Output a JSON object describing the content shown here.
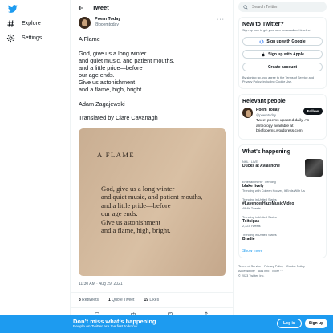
{
  "nav": {
    "explore": "Explore",
    "settings": "Settings"
  },
  "header": {
    "title": "Tweet"
  },
  "tweet": {
    "author_name": "Poem Today",
    "author_handle": "@poemtoday",
    "title": "A Flame",
    "lines": [
      "God, give us a long winter",
      "and quiet music, and patient mouths,",
      "and a little pride—before",
      "our age ends.",
      "Give us astonishment",
      "and a flame, high, bright."
    ],
    "poet": "Adam Zagajewski",
    "translator": "Translated by Clare Cavanagh",
    "photo_title": "A FLAME",
    "photo_lines": [
      "God, give us a long winter",
      "and quiet music, and patient mouths,",
      "and a little pride—before",
      "our age ends.",
      "Give us astonishment",
      "and a flame, high, bright."
    ],
    "timestamp": "11:30 AM · Aug 29, 2021",
    "retweets_count": "3",
    "retweets_label": "Retweets",
    "quotes_count": "1",
    "quotes_label": "Quote Tweet",
    "likes_count": "19",
    "likes_label": "Likes"
  },
  "search": {
    "placeholder": "Search Twitter"
  },
  "new_to_twitter": {
    "title": "New to Twitter?",
    "subtitle": "Sign up now to get your own personalized timeline!",
    "google": "Sign up with Google",
    "apple": "Sign up with Apple",
    "create": "Create account",
    "terms": "By signing up, you agree to the Terms of Service and Privacy Policy, including Cookie Use."
  },
  "relevant": {
    "title": "Relevant people",
    "name": "Poem Today",
    "handle": "@poemtoday",
    "follow": "Follow",
    "bio": "Tweet poems updated daily. An anthology available at briefpoems.wordpress.com"
  },
  "happening": {
    "title": "What's happening",
    "trends": [
      {
        "ctx": "NHL · LIVE",
        "name": "Ducks at Avalanche",
        "count": ""
      },
      {
        "ctx": "Entertainment · Trending",
        "name": "blake lively",
        "count": "Trending with Colleen Hoover, It Ends With Us"
      },
      {
        "ctx": "Trending in United States",
        "name": "#LavenderHazeMusicVideo",
        "count": "49.4K Tweets"
      },
      {
        "ctx": "Trending in United States",
        "name": "Tsitsipas",
        "count": "2,323 Tweets"
      },
      {
        "ctx": "Trending in United States",
        "name": "Bradie",
        "count": ""
      }
    ],
    "show_more": "Show more"
  },
  "footer": {
    "links": [
      "Terms of Service",
      "Privacy Policy",
      "Cookie Policy",
      "Accessibility",
      "Ads info",
      "More ···"
    ],
    "copyright": "© 2023 Twitter, Inc."
  },
  "bottom_bar": {
    "headline": "Don’t miss what’s happening",
    "sub": "People on Twitter are the first to know.",
    "login": "Log in",
    "signup": "Sign up"
  },
  "colors": {
    "accent": "#1d9bf0",
    "text": "#0f1419",
    "muted": "#536471"
  }
}
